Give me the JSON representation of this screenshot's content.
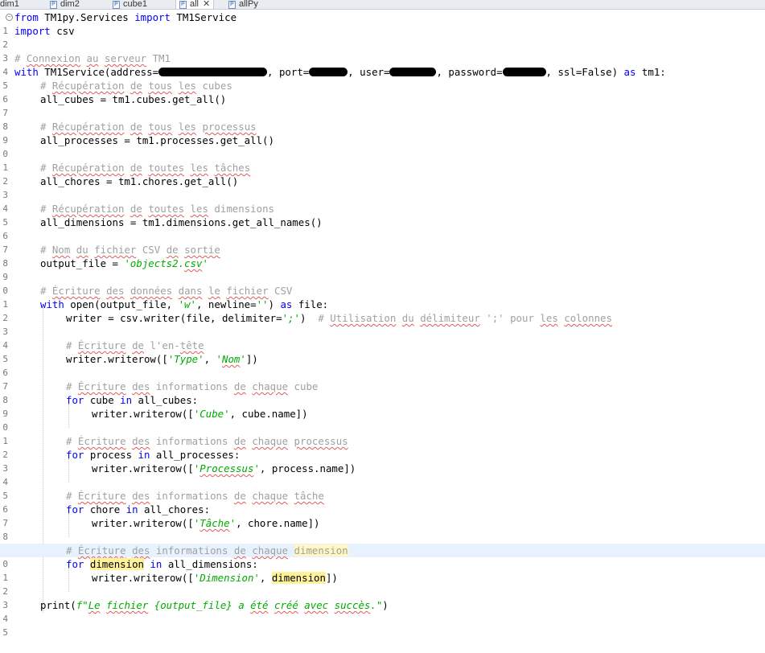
{
  "tabs": [
    {
      "label": "dim1",
      "active": false
    },
    {
      "label": "dim2",
      "active": false
    },
    {
      "label": "cube1",
      "active": false
    },
    {
      "label": "all",
      "active": true
    },
    {
      "label": "allPy",
      "active": false
    }
  ],
  "editor": {
    "line_numbers": [
      "1",
      "2",
      "3",
      "4",
      "5",
      "6",
      "7",
      "8",
      "9",
      "0",
      "1",
      "2",
      "3",
      "4",
      "5",
      "6",
      "7",
      "8",
      "9",
      "0",
      "1",
      "2",
      "3",
      "4",
      "5",
      "6",
      "7",
      "8",
      "9",
      "0",
      "1",
      "2",
      "3",
      "4",
      "5",
      "6",
      "7",
      "8",
      "9",
      "0",
      "1",
      "2",
      "3",
      "4",
      "5"
    ],
    "current_line": 40,
    "code": {
      "l1": {
        "a": "from",
        "b": " TM1py.Services ",
        "c": "import",
        "d": " TM1Service"
      },
      "l2": {
        "a": "import",
        "b": " csv"
      },
      "l4": {
        "a": "# ",
        "b": "Connexion",
        "c": " ",
        "d": "au",
        "e": " ",
        "f": "serveur",
        "g": " TM1"
      },
      "l5": {
        "a": "with",
        "b": " TM1Service(address=",
        "c": ", port=",
        "d": ", user=",
        "e": ", password=",
        "f": ", ssl=False) ",
        "g": "as",
        "h": " tm1:"
      },
      "l6": {
        "a": "# ",
        "b": "Récupération",
        "c": " ",
        "d": "de",
        "e": " ",
        "f": "tous",
        "g": " ",
        "h": "les",
        "i": " cubes"
      },
      "l7": "all_cubes = tm1.cubes.get_all()",
      "l9": {
        "a": "# ",
        "b": "Récupération",
        "c": " ",
        "d": "de",
        "e": " ",
        "f": "tous",
        "g": " ",
        "h": "les",
        "i": " ",
        "j": "processus"
      },
      "l10": "all_processes = tm1.processes.get_all()",
      "l12": {
        "a": "# ",
        "b": "Récupération",
        "c": " ",
        "d": "de",
        "e": " ",
        "f": "toutes",
        "g": " ",
        "h": "les",
        "i": " ",
        "j": "tâches"
      },
      "l13": "all_chores = tm1.chores.get_all()",
      "l15": {
        "a": "# ",
        "b": "Récupération",
        "c": " ",
        "d": "de",
        "e": " ",
        "f": "toutes",
        "g": " ",
        "h": "les",
        "i": " dimensions"
      },
      "l16": "all_dimensions = tm1.dimensions.get_all_names()",
      "l18": {
        "a": "# ",
        "b": "Nom",
        "c": " ",
        "d": "du",
        "e": " ",
        "f": "fichier",
        "g": " CSV ",
        "h": "de",
        "i": " ",
        "j": "sortie"
      },
      "l19": {
        "a": "output_file = ",
        "b": "'objects2.",
        "c": "csv",
        "d": "'"
      },
      "l21": {
        "a": "# ",
        "b": "Écriture",
        "c": " ",
        "d": "des",
        "e": " ",
        "f": "données",
        "g": " ",
        "h": "dans",
        "i": " ",
        "j": "le",
        "k": " ",
        "l": "fichier",
        "m": " CSV"
      },
      "l22": {
        "a": "with",
        "b": " open(output_file, ",
        "c": "'w'",
        "d": ", newline=",
        "e": "''",
        "f": ") ",
        "g": "as",
        "h": " file:"
      },
      "l23": {
        "a": "writer = csv.writer(file, delimiter=",
        "b": "';'",
        "c": ")  ",
        "d": "# ",
        "e": "Utilisation",
        "f": " ",
        "g": "du",
        "h": " ",
        "i": "délimiteur",
        "j": " ';' pour ",
        "k": "les",
        "l": " ",
        "m": "colonnes"
      },
      "l25": {
        "a": "# ",
        "b": "Écriture",
        "c": " ",
        "d": "de",
        "e": " l'en-",
        "f": "tête"
      },
      "l26": {
        "a": "writer.writerow([",
        "b": "'Type'",
        "c": ", ",
        "d": "'",
        "e": "Nom",
        "f": "'",
        "g": "])"
      },
      "l28": {
        "a": "# ",
        "b": "Écriture",
        "c": " ",
        "d": "des",
        "e": " informations ",
        "f": "de",
        "g": " ",
        "h": "chaque",
        "i": " cube"
      },
      "l29": {
        "a": "for",
        "b": " cube ",
        "c": "in",
        "d": " all_cubes:"
      },
      "l30": {
        "a": "writer.writerow([",
        "b": "'Cube'",
        "c": ", cube.name])"
      },
      "l32": {
        "a": "# ",
        "b": "Écriture",
        "c": " ",
        "d": "des",
        "e": " informations ",
        "f": "de",
        "g": " ",
        "h": "chaque",
        "i": " ",
        "j": "processus"
      },
      "l33": {
        "a": "for",
        "b": " process ",
        "c": "in",
        "d": " all_processes:"
      },
      "l34": {
        "a": "writer.writerow([",
        "b": "'",
        "c": "Processus",
        "d": "'",
        "e": ", process.name])"
      },
      "l36": {
        "a": "# ",
        "b": "Écriture",
        "c": " ",
        "d": "des",
        "e": " informations ",
        "f": "de",
        "g": " ",
        "h": "chaque",
        "i": " ",
        "j": "tâche"
      },
      "l37": {
        "a": "for",
        "b": " chore ",
        "c": "in",
        "d": " all_chores:"
      },
      "l38": {
        "a": "writer.writerow([",
        "b": "'",
        "c": "Tâche",
        "d": "'",
        "e": ", chore.name])"
      },
      "l40": {
        "a": "# ",
        "b": "Écriture",
        "c": " ",
        "d": "des",
        "e": " informations ",
        "f": "de",
        "g": " ",
        "h": "chaque",
        "i": " ",
        "j": "dimension"
      },
      "l41": {
        "a": "for",
        "b": " ",
        "c": "dimension",
        "d": " ",
        "e": "in",
        "f": " all_dimensions:"
      },
      "l42": {
        "a": "writer.writerow([",
        "b": "'Dimension'",
        "c": ", ",
        "d": "dimension",
        "e": "])"
      },
      "l44": {
        "a": "print(",
        "b": "f\"",
        "c": "Le",
        "d": " ",
        "e": "fichier",
        "f": " {output_file} a ",
        "g": "été",
        "h": " ",
        "i": "créé",
        "j": " ",
        "k": "avec",
        "l": " ",
        "m": "succès",
        "n": ".\"",
        "o": ")"
      }
    }
  }
}
